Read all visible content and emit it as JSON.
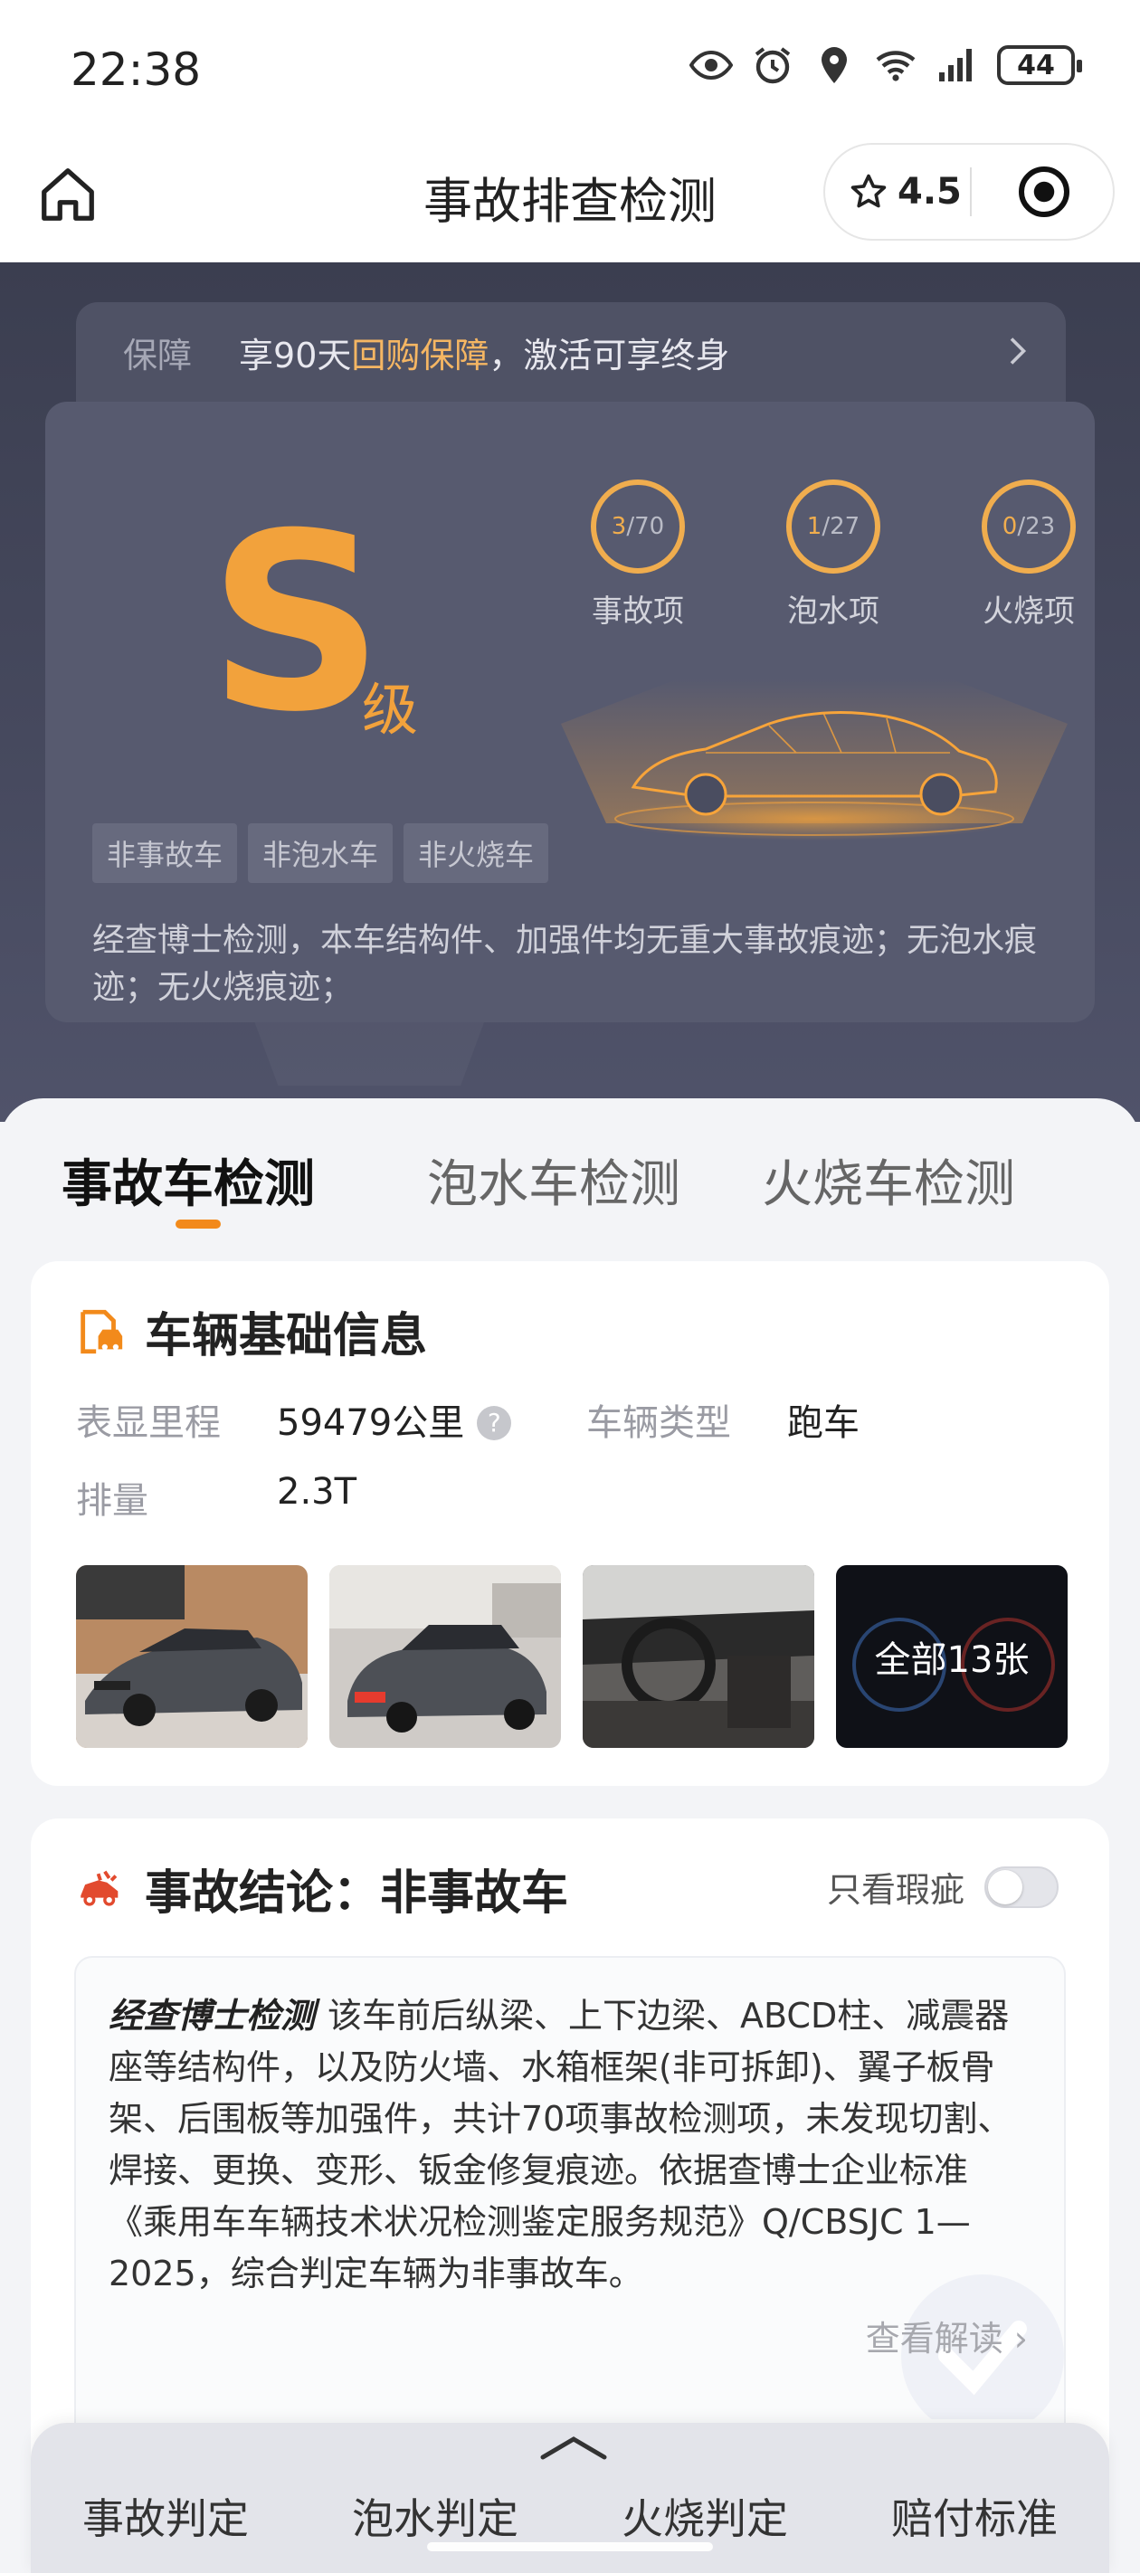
{
  "status_bar": {
    "time": "22:38",
    "battery": "44"
  },
  "header": {
    "title": "事故排查检测",
    "rating": "4.5"
  },
  "guarantee": {
    "label": "保障",
    "text_before": "享90天",
    "highlight": "回购保障",
    "text_after": "，激活可享终身"
  },
  "grade": {
    "letter": "S",
    "suffix": "级",
    "checks": [
      {
        "done": "3",
        "total": "/70",
        "label": "事故项",
        "progress": 0.043
      },
      {
        "done": "1",
        "total": "/27",
        "label": "泡水项",
        "progress": 0.037
      },
      {
        "done": "0",
        "total": "/23",
        "label": "火烧项",
        "progress": 0.0
      }
    ],
    "tags": [
      "非事故车",
      "非泡水车",
      "非火烧车"
    ],
    "description": "经查博士检测，本车结构件、加强件均无重大事故痕迹；无泡水痕迹；无火烧痕迹；"
  },
  "tabs": [
    {
      "label": "事故车检测",
      "active": true
    },
    {
      "label": "泡水车检测",
      "active": false
    },
    {
      "label": "火烧车检测",
      "active": false
    }
  ],
  "basic_info": {
    "title": "车辆基础信息",
    "mileage_label": "表显里程",
    "mileage_value": "59479公里",
    "type_label": "车辆类型",
    "type_value": "跑车",
    "displacement_label": "排量",
    "displacement_value": "2.3T",
    "photos_all_label": "全部13张"
  },
  "conclusion": {
    "title": "事故结论：非事故车",
    "filter_label": "只看瑕疵",
    "brand": "经查博士检测",
    "text": "该车前后纵梁、上下边梁、ABCD柱、减震器座等结构件，以及防火墙、水箱框架(非可拆卸)、翼子板骨架、后围板等加强件，共计70项事故检测项，未发现切割、焊接、更换、变形、钣金修复痕迹。依据查博士企业标准《乘用车车辆技术状况检测鉴定服务规范》Q/CBSJC 1—2025，综合判定车辆为非事故车。",
    "more_label": "查看解读"
  },
  "bottom_nav": [
    "事故判定",
    "泡水判定",
    "火烧判定",
    "赔付标准"
  ],
  "colors": {
    "accent": "#f2a23c",
    "hero_bg": "#3b3e50",
    "tab_underline": "#f28a1b",
    "danger": "#e24a2e"
  }
}
